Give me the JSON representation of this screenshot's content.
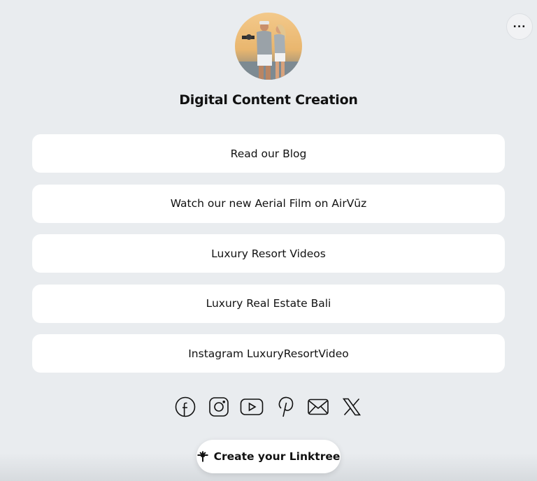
{
  "profile": {
    "title": "Digital Content Creation",
    "avatar_alt": "profile photo"
  },
  "header": {
    "more_label": "..."
  },
  "links": [
    {
      "label": "Read our Blog"
    },
    {
      "label": "Watch our new Aerial Film on AirVūz"
    },
    {
      "label": "Luxury Resort Videos"
    },
    {
      "label": "Luxury Real Estate Bali"
    },
    {
      "label": "Instagram LuxuryResortVideo"
    }
  ],
  "socials": [
    {
      "icon": "facebook-icon"
    },
    {
      "icon": "instagram-icon"
    },
    {
      "icon": "youtube-icon"
    },
    {
      "icon": "pinterest-icon"
    },
    {
      "icon": "email-icon"
    },
    {
      "icon": "x-icon"
    }
  ],
  "cta": {
    "label": "Create your Linktree",
    "icon": "linktree-icon"
  },
  "colors": {
    "background": "#e9ecef",
    "card": "#ffffff",
    "text": "#111111"
  }
}
